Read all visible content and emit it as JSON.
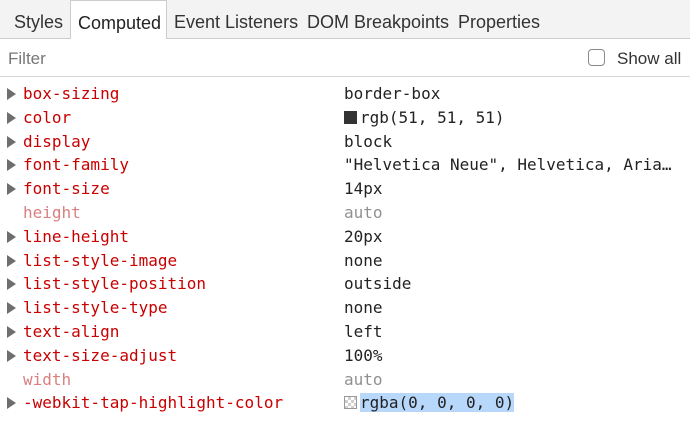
{
  "tabs": [
    {
      "label": "Styles"
    },
    {
      "label": "Computed"
    },
    {
      "label": "Event Listeners"
    },
    {
      "label": "DOM Breakpoints"
    },
    {
      "label": "Properties"
    }
  ],
  "active_tab": "Computed",
  "filter": {
    "placeholder": "Filter",
    "value": ""
  },
  "show_all": {
    "label": "Show all",
    "checked": false
  },
  "properties": [
    {
      "name": "box-sizing",
      "value": "border-box",
      "expandable": true,
      "inherited": false
    },
    {
      "name": "color",
      "value": "rgb(51, 51, 51)",
      "expandable": true,
      "inherited": false,
      "swatch": "#333333"
    },
    {
      "name": "display",
      "value": "block",
      "expandable": true,
      "inherited": false
    },
    {
      "name": "font-family",
      "value": "\"Helvetica Neue\", Helvetica, Aria…",
      "expandable": true,
      "inherited": false
    },
    {
      "name": "font-size",
      "value": "14px",
      "expandable": true,
      "inherited": false
    },
    {
      "name": "height",
      "value": "auto",
      "expandable": false,
      "inherited": true
    },
    {
      "name": "line-height",
      "value": "20px",
      "expandable": true,
      "inherited": false
    },
    {
      "name": "list-style-image",
      "value": "none",
      "expandable": true,
      "inherited": false
    },
    {
      "name": "list-style-position",
      "value": "outside",
      "expandable": true,
      "inherited": false
    },
    {
      "name": "list-style-type",
      "value": "none",
      "expandable": true,
      "inherited": false
    },
    {
      "name": "text-align",
      "value": "left",
      "expandable": true,
      "inherited": false
    },
    {
      "name": "text-size-adjust",
      "value": "100%",
      "expandable": true,
      "inherited": false
    },
    {
      "name": "width",
      "value": "auto",
      "expandable": false,
      "inherited": true
    },
    {
      "name": "-webkit-tap-highlight-color",
      "value": "rgba(0, 0, 0, 0)",
      "expandable": true,
      "inherited": false,
      "swatch": "transparent",
      "selected": true
    }
  ],
  "colors": {
    "property_name": "#c80000",
    "property_name_inherited": "#d98080",
    "value_inherited": "#909090",
    "selection": "#b8d8fb",
    "tabbar_bg": "#f3f3f3"
  }
}
